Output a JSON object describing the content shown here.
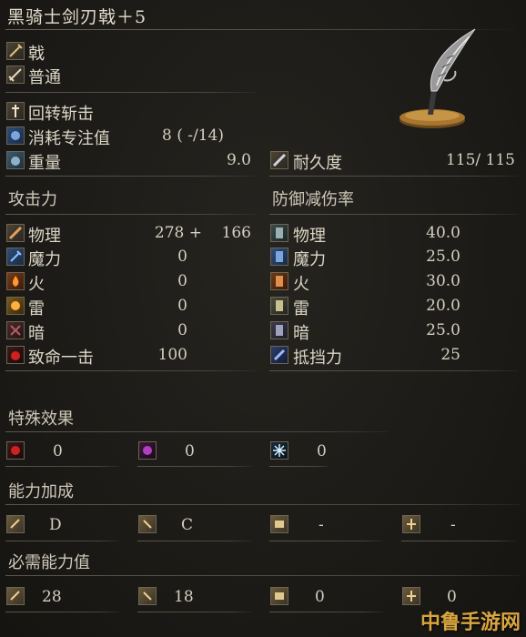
{
  "title": "黑骑士剑刃戟＋5",
  "weapon_info": {
    "type": "戟",
    "attack_type": "普通",
    "skill": "回转斩击",
    "fp_cost_label": "消耗专注值",
    "fp_cost_value": "8 (   -/14)",
    "weight_label": "重量",
    "weight_value": "9.0",
    "durability_label": "耐久度",
    "durability_value": "115/   115"
  },
  "attack": {
    "header": "攻击力",
    "rows": [
      {
        "label": "物理",
        "value": "278 +",
        "bonus": "166"
      },
      {
        "label": "魔力",
        "value": "0",
        "bonus": ""
      },
      {
        "label": "火",
        "value": "0",
        "bonus": ""
      },
      {
        "label": "雷",
        "value": "0",
        "bonus": ""
      },
      {
        "label": "暗",
        "value": "0",
        "bonus": ""
      },
      {
        "label": "致命一击",
        "value": "100",
        "bonus": ""
      }
    ]
  },
  "defense": {
    "header": "防御减伤率",
    "rows": [
      {
        "label": "物理",
        "value": "40.0"
      },
      {
        "label": "魔力",
        "value": "25.0"
      },
      {
        "label": "火",
        "value": "30.0"
      },
      {
        "label": "雷",
        "value": "20.0"
      },
      {
        "label": "暗",
        "value": "25.0"
      },
      {
        "label": "抵挡力",
        "value": "25"
      }
    ]
  },
  "special_effects": {
    "header": "特殊效果",
    "items": [
      {
        "icon": "bleed-icon",
        "value": "0"
      },
      {
        "icon": "poison-icon",
        "value": "0"
      },
      {
        "icon": "frost-icon",
        "value": "0"
      }
    ]
  },
  "scaling": {
    "header": "能力加成",
    "items": [
      {
        "icon": "strength-icon",
        "value": "D"
      },
      {
        "icon": "dexterity-icon",
        "value": "C"
      },
      {
        "icon": "intelligence-icon",
        "value": "-"
      },
      {
        "icon": "faith-icon",
        "value": "-"
      }
    ]
  },
  "requirements": {
    "header": "必需能力值",
    "items": [
      {
        "icon": "strength-icon",
        "value": "28"
      },
      {
        "icon": "dexterity-icon",
        "value": "18"
      },
      {
        "icon": "intelligence-icon",
        "value": "0"
      },
      {
        "icon": "faith-icon",
        "value": "0"
      }
    ]
  },
  "watermark": "中鲁手游网",
  "colors": {
    "background": "#1c1b18",
    "text": "#ddd6c6",
    "divider": "#5a554a",
    "watermark": "#d9a640"
  }
}
